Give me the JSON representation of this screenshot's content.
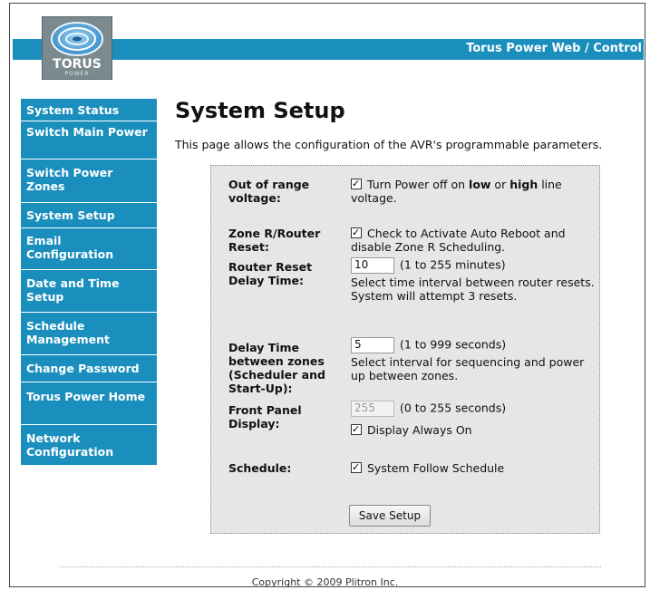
{
  "header": {
    "brand_title": "Torus Power Web / Control",
    "logo_text": "TORUS",
    "logo_sub": "POWER"
  },
  "sidebar": {
    "items": [
      {
        "label": "System Status"
      },
      {
        "label": "Switch Main Power"
      },
      {
        "label": "Switch Power Zones"
      },
      {
        "label": "System Setup"
      },
      {
        "label": "Email Configuration"
      },
      {
        "label": "Date and Time Setup"
      },
      {
        "label": "Schedule Management"
      },
      {
        "label": "Change Password"
      },
      {
        "label": "Torus Power Home"
      },
      {
        "label": "Network Configuration"
      }
    ]
  },
  "main": {
    "title": "System Setup",
    "intro": "This page allows the configuration of the AVR's programmable parameters."
  },
  "form": {
    "out_of_range": {
      "label": "Out of range voltage:",
      "checked": true,
      "text_pre": "Turn Power off on ",
      "bold1": "low",
      "text_mid": " or ",
      "bold2": "high",
      "text_post": " line voltage."
    },
    "zone_r": {
      "label": "Zone R/Router Reset:",
      "checked": true,
      "text": "Check to Activate Auto Reboot and disable Zone R Scheduling."
    },
    "router_delay": {
      "label": "Router Reset Delay Time:",
      "value": "10",
      "range": "(1 to 255 minutes)",
      "help": "Select time interval between router resets. System will attempt 3 resets."
    },
    "zone_delay": {
      "label": "Delay Time between zones (Scheduler and Start-Up):",
      "value": "5",
      "range": "(1 to 999 seconds)",
      "help": "Select interval for sequencing and power up between zones."
    },
    "front_panel": {
      "label": "Front Panel Display:",
      "value": "255",
      "range": "(0 to 255 seconds)",
      "checked": true,
      "checkbox_label": "Display Always On"
    },
    "schedule": {
      "label": "Schedule:",
      "checked": true,
      "checkbox_label": "System Follow Schedule"
    },
    "save_label": "Save Setup"
  },
  "footer": {
    "copyright": "Copyright © 2009 Plitron Inc."
  },
  "colors": {
    "accent": "#1a8fbd",
    "panel_bg": "#e6e6e6"
  },
  "icons": [
    "torus-logo-icon",
    "checkbox-checked-icon"
  ]
}
